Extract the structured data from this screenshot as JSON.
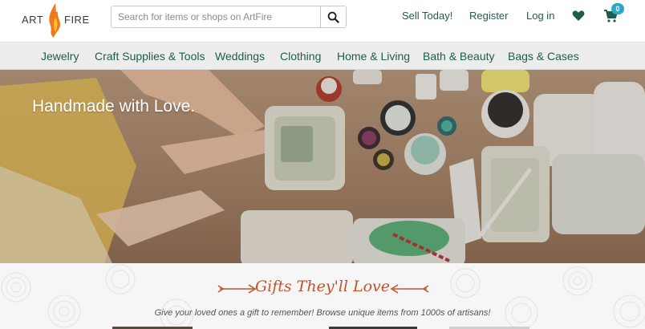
{
  "brand": {
    "logo_left": "ART",
    "logo_right": "FIRE",
    "flame_color": "#f07a1a"
  },
  "search": {
    "placeholder": "Search for items or shops on ArtFire",
    "value": "",
    "icon": "search-icon"
  },
  "header_links": {
    "sell": "Sell Today!",
    "register": "Register",
    "login": "Log in"
  },
  "cart": {
    "count": "0",
    "icon": "cart-icon"
  },
  "wishlist": {
    "icon": "heart-icon"
  },
  "categories": [
    "Jewelry",
    "Craft Supplies & Tools",
    "Weddings",
    "Clothing",
    "Home & Living",
    "Bath & Beauty",
    "Bags & Cases"
  ],
  "hero": {
    "title": "Handmade with Love."
  },
  "gifts": {
    "title": "Gifts They'll Love",
    "subtitle": "Give your loved ones a gift to remember! Browse unique items from 1000s of artisans!"
  },
  "colors": {
    "link": "#1f5c4f",
    "accent": "#c0552b",
    "badge": "#2aa7c9",
    "nav_bg": "#ededed"
  }
}
